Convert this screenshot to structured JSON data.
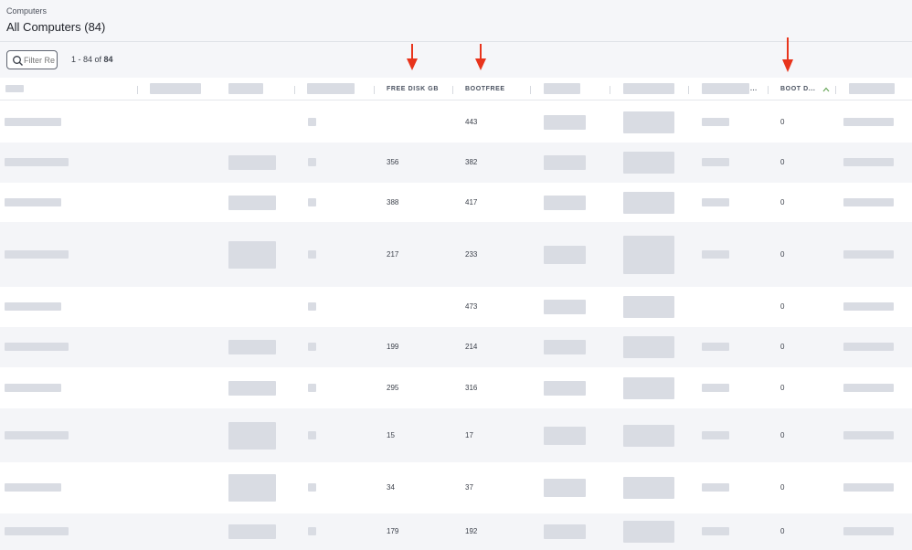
{
  "header": {
    "breadcrumb": "Computers",
    "title": "All Computers (84)"
  },
  "toolbar": {
    "filter_placeholder": "Filter Re",
    "count_prefix": "1 - 84 of ",
    "count_total": "84"
  },
  "columns": {
    "free_disk": "FREE DISK GB",
    "bootfree": "BOOTFREE",
    "boot_d": "BOOT D...",
    "truncated": "..."
  },
  "rows": [
    {
      "free_disk": "",
      "bootfree": "443",
      "boot_d": "0"
    },
    {
      "free_disk": "356",
      "bootfree": "382",
      "boot_d": "0"
    },
    {
      "free_disk": "388",
      "bootfree": "417",
      "boot_d": "0"
    },
    {
      "free_disk": "217",
      "bootfree": "233",
      "boot_d": "0"
    },
    {
      "free_disk": "",
      "bootfree": "473",
      "boot_d": "0"
    },
    {
      "free_disk": "199",
      "bootfree": "214",
      "boot_d": "0"
    },
    {
      "free_disk": "295",
      "bootfree": "316",
      "boot_d": "0"
    },
    {
      "free_disk": "15",
      "bootfree": "17",
      "boot_d": "0"
    },
    {
      "free_disk": "34",
      "bootfree": "37",
      "boot_d": "0"
    },
    {
      "free_disk": "179",
      "bootfree": "192",
      "boot_d": "0"
    }
  ],
  "colors": {
    "arrow": "#e8341c",
    "sort_accent": "#6aa85b",
    "alt_row": "#f4f5f8"
  },
  "icons": {
    "filter": "search-icon",
    "sort": "sort-ascending-icon",
    "annotation": "red-arrow-icon"
  }
}
